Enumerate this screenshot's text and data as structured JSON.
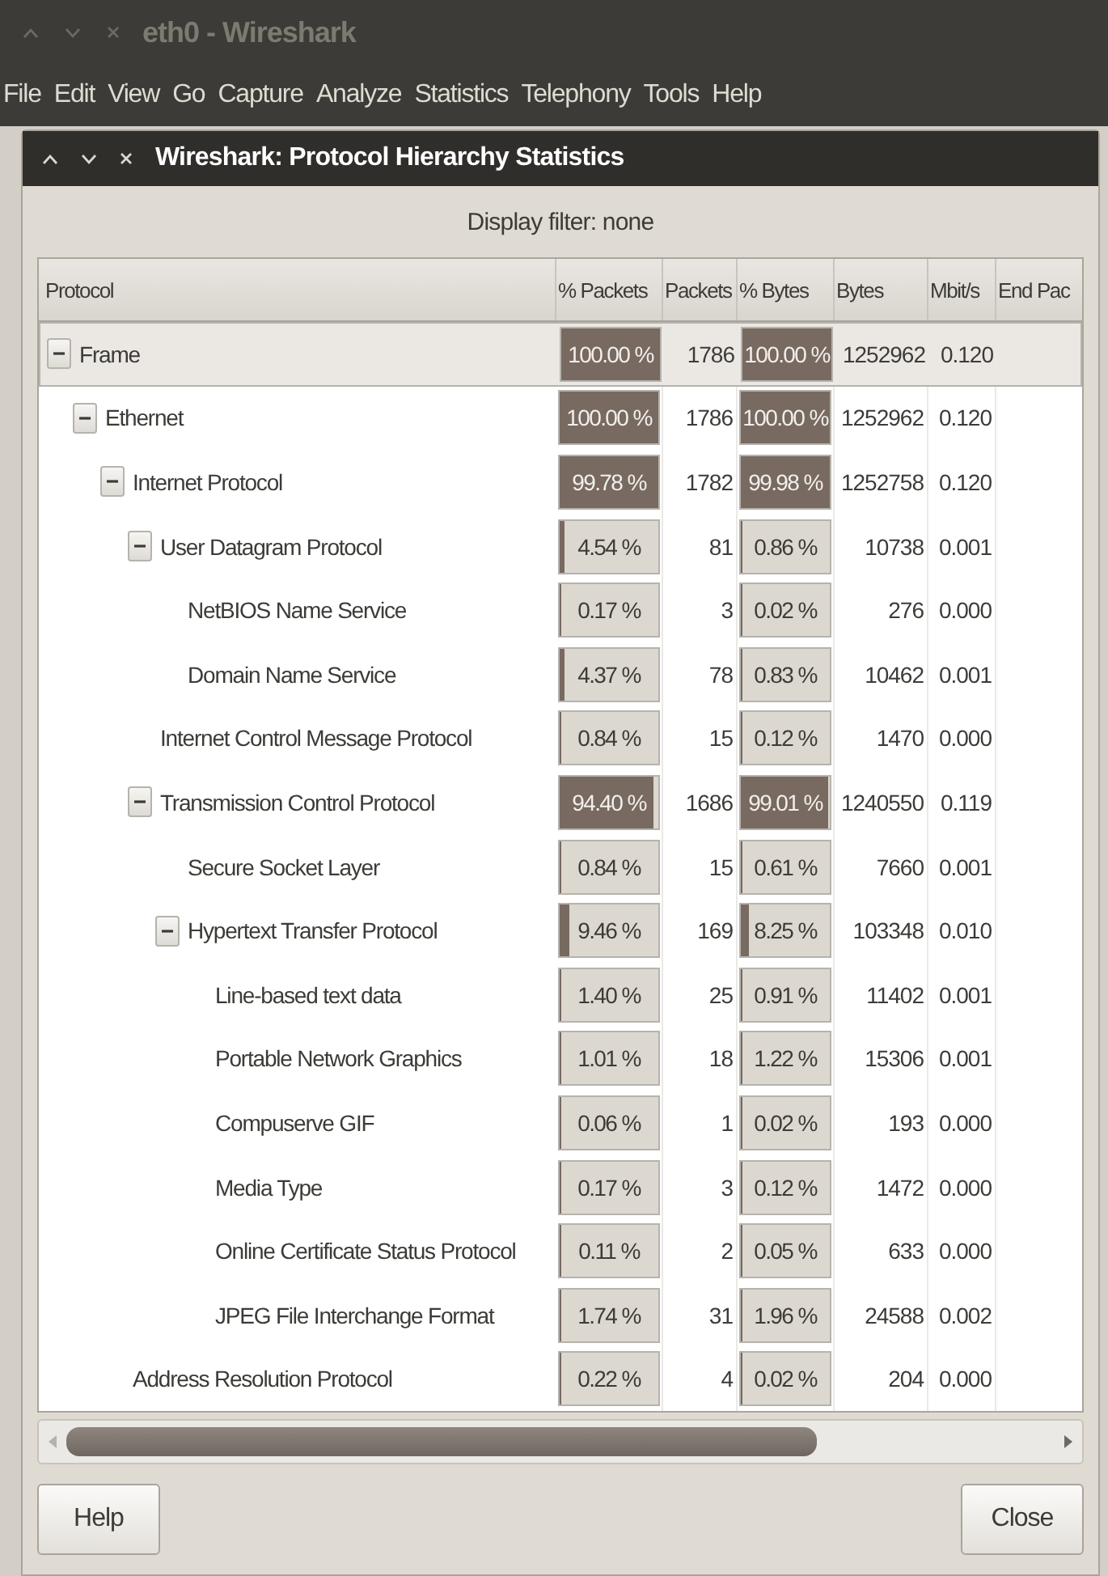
{
  "window": {
    "title": "eth0 - Wireshark"
  },
  "menu": [
    "File",
    "Edit",
    "View",
    "Go",
    "Capture",
    "Analyze",
    "Statistics",
    "Telephony",
    "Tools",
    "Help"
  ],
  "dialog": {
    "title": "Wireshark: Protocol Hierarchy Statistics",
    "display_filter": "Display filter: none"
  },
  "table": {
    "columns": [
      "Protocol",
      "% Packets",
      "Packets",
      "% Bytes",
      "Bytes",
      "Mbit/s",
      "End Pac"
    ],
    "rows": [
      {
        "protocol": "Frame",
        "selected": true,
        "expanded": true,
        "pct_packets": {
          "text": "100.00 %",
          "level": 1
        },
        "packets": "1786",
        "pct_bytes": {
          "text": "100.00 %",
          "level": 1
        },
        "bytes": "1252962",
        "mbits": "0.120",
        "children": [
          {
            "protocol": "Ethernet",
            "selected": false,
            "expanded": true,
            "pct_packets": {
              "text": "100.00 %",
              "level": 1
            },
            "packets": "1786",
            "pct_bytes": {
              "text": "100.00 %",
              "level": 1
            },
            "bytes": "1252962",
            "mbits": "0.120",
            "children": [
              {
                "protocol": "Internet Protocol",
                "selected": false,
                "expanded": true,
                "pct_packets": {
                  "text": "99.78 %",
                  "level": 0.9978
                },
                "packets": "1782",
                "pct_bytes": {
                  "text": "99.98 %",
                  "level": 0.9998
                },
                "bytes": "1252758",
                "mbits": "0.120",
                "children": [
                  {
                    "protocol": "User Datagram Protocol",
                    "selected": false,
                    "expanded": true,
                    "pct_packets": {
                      "text": "4.54 %",
                      "level": 0.0454
                    },
                    "packets": "81",
                    "pct_bytes": {
                      "text": "0.86 %",
                      "level": 0.0086
                    },
                    "bytes": "10738",
                    "mbits": "0.001",
                    "children": [
                      {
                        "protocol": "NetBIOS Name Service",
                        "selected": false,
                        "pct_packets": {
                          "text": "0.17 %",
                          "level": 0.0017
                        },
                        "packets": "3",
                        "pct_bytes": {
                          "text": "0.02 %",
                          "level": 0.0002
                        },
                        "bytes": "276",
                        "mbits": "0.000"
                      },
                      {
                        "protocol": "Domain Name Service",
                        "selected": false,
                        "pct_packets": {
                          "text": "4.37 %",
                          "level": 0.0437
                        },
                        "packets": "78",
                        "pct_bytes": {
                          "text": "0.83 %",
                          "level": 0.0083
                        },
                        "bytes": "10462",
                        "mbits": "0.001"
                      }
                    ]
                  },
                  {
                    "protocol": "Internet Control Message Protocol",
                    "selected": false,
                    "pct_packets": {
                      "text": "0.84 %",
                      "level": 0.0084
                    },
                    "packets": "15",
                    "pct_bytes": {
                      "text": "0.12 %",
                      "level": 0.0012
                    },
                    "bytes": "1470",
                    "mbits": "0.000"
                  },
                  {
                    "protocol": "Transmission Control Protocol",
                    "selected": false,
                    "expanded": true,
                    "pct_packets": {
                      "text": "94.40 %",
                      "level": 0.944
                    },
                    "packets": "1686",
                    "pct_bytes": {
                      "text": "99.01 %",
                      "level": 0.9901
                    },
                    "bytes": "1240550",
                    "mbits": "0.119",
                    "children": [
                      {
                        "protocol": "Secure Socket Layer",
                        "selected": false,
                        "pct_packets": {
                          "text": "0.84 %",
                          "level": 0.0084
                        },
                        "packets": "15",
                        "pct_bytes": {
                          "text": "0.61 %",
                          "level": 0.0061
                        },
                        "bytes": "7660",
                        "mbits": "0.001"
                      },
                      {
                        "protocol": "Hypertext Transfer Protocol",
                        "selected": false,
                        "expanded": true,
                        "pct_packets": {
                          "text": "9.46 %",
                          "level": 0.0946
                        },
                        "packets": "169",
                        "pct_bytes": {
                          "text": "8.25 %",
                          "level": 0.0825
                        },
                        "bytes": "103348",
                        "mbits": "0.010",
                        "children": [
                          {
                            "protocol": "Line-based text data",
                            "selected": false,
                            "pct_packets": {
                              "text": "1.40 %",
                              "level": 0.014
                            },
                            "packets": "25",
                            "pct_bytes": {
                              "text": "0.91 %",
                              "level": 0.0091
                            },
                            "bytes": "11402",
                            "mbits": "0.001"
                          },
                          {
                            "protocol": "Portable Network Graphics",
                            "selected": false,
                            "pct_packets": {
                              "text": "1.01 %",
                              "level": 0.0101
                            },
                            "packets": "18",
                            "pct_bytes": {
                              "text": "1.22 %",
                              "level": 0.0122
                            },
                            "bytes": "15306",
                            "mbits": "0.001"
                          },
                          {
                            "protocol": "Compuserve GIF",
                            "selected": false,
                            "pct_packets": {
                              "text": "0.06 %",
                              "level": 0.0006
                            },
                            "packets": "1",
                            "pct_bytes": {
                              "text": "0.02 %",
                              "level": 0.0002
                            },
                            "bytes": "193",
                            "mbits": "0.000"
                          },
                          {
                            "protocol": "Media Type",
                            "selected": false,
                            "pct_packets": {
                              "text": "0.17 %",
                              "level": 0.0017
                            },
                            "packets": "3",
                            "pct_bytes": {
                              "text": "0.12 %",
                              "level": 0.0012
                            },
                            "bytes": "1472",
                            "mbits": "0.000"
                          },
                          {
                            "protocol": "Online Certificate Status Protocol",
                            "selected": false,
                            "pct_packets": {
                              "text": "0.11 %",
                              "level": 0.0011
                            },
                            "packets": "2",
                            "pct_bytes": {
                              "text": "0.05 %",
                              "level": 0.0005
                            },
                            "bytes": "633",
                            "mbits": "0.000"
                          },
                          {
                            "protocol": "JPEG File Interchange Format",
                            "selected": false,
                            "pct_packets": {
                              "text": "1.74 %",
                              "level": 0.0174
                            },
                            "packets": "31",
                            "pct_bytes": {
                              "text": "1.96 %",
                              "level": 0.0196
                            },
                            "bytes": "24588",
                            "mbits": "0.002"
                          }
                        ]
                      }
                    ]
                  }
                ]
              },
              {
                "protocol": "Address Resolution Protocol",
                "selected": false,
                "pct_packets": {
                  "text": "0.22 %",
                  "level": 0.0022
                },
                "packets": "4",
                "pct_bytes": {
                  "text": "0.02 %",
                  "level": 0.0002
                },
                "bytes": "204",
                "mbits": "0.000"
              }
            ]
          }
        ]
      }
    ]
  },
  "buttons": [
    {
      "kind": "help",
      "label": "Help"
    },
    {
      "kind": "close",
      "label": "Close"
    }
  ]
}
